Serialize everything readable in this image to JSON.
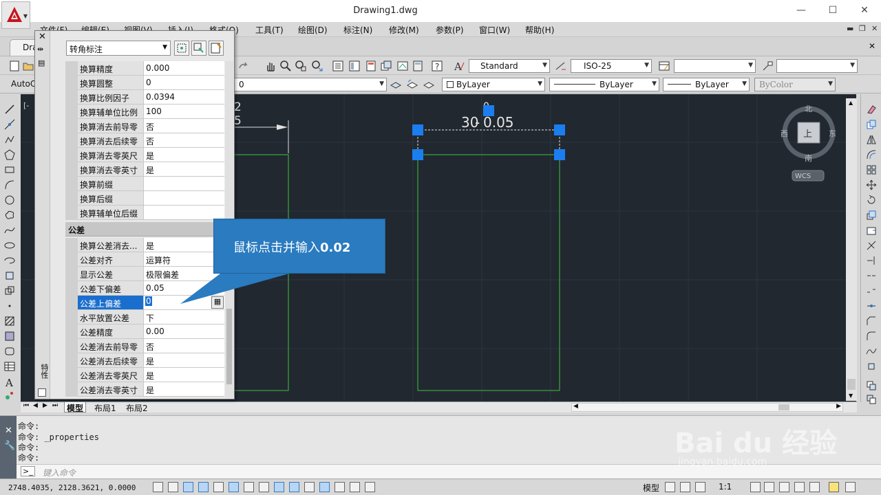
{
  "window": {
    "title": "Drawing1.dwg",
    "minimize": "—",
    "maximize": "☐",
    "close": "✕"
  },
  "menu": [
    "文件(F)",
    "编辑(E)",
    "视图(V)",
    "插入(I)",
    "格式(O)",
    "工具(T)",
    "绘图(D)",
    "标注(N)",
    "修改(M)",
    "参数(P)",
    "窗口(W)",
    "帮助(H)"
  ],
  "doc_tab": "Dra",
  "toolbar1": {
    "text_style": "Standard",
    "dim_style": "ISO-25"
  },
  "toolbar2": {
    "workspace": "AutoC",
    "layer": "0",
    "color": "ByLayer",
    "linetype": "ByLayer",
    "lineweight": "ByLayer",
    "plotstyle": "ByColor"
  },
  "palette": {
    "object_type": "转角标注",
    "side_label": "特性",
    "alt_units_rows": [
      {
        "name": "换算精度",
        "value": "0.000"
      },
      {
        "name": "换算圆整",
        "value": "0"
      },
      {
        "name": "换算比例因子",
        "value": "0.0394"
      },
      {
        "name": "换算辅单位比例",
        "value": "100"
      },
      {
        "name": "换算消去前导零",
        "value": "否"
      },
      {
        "name": "换算消去后续零",
        "value": "否"
      },
      {
        "name": "换算消去零英尺",
        "value": "是"
      },
      {
        "name": "换算消去零英寸",
        "value": "是"
      },
      {
        "name": "换算前缀",
        "value": ""
      },
      {
        "name": "换算后缀",
        "value": ""
      },
      {
        "name": "换算辅单位后缀",
        "value": ""
      }
    ],
    "tolerance_section": "公差",
    "tolerance_rows": [
      {
        "name": "换算公差消去...",
        "value": "是"
      },
      {
        "name": "公差对齐",
        "value": "运算符"
      },
      {
        "name": "显示公差",
        "value": "极限偏差"
      },
      {
        "name": "公差下偏差",
        "value": "0.05"
      },
      {
        "name": "公差上偏差",
        "value": "0"
      },
      {
        "name": "水平放置公差",
        "value": "下"
      },
      {
        "name": "公差精度",
        "value": "0.00"
      },
      {
        "name": "公差消去前导零",
        "value": "否"
      },
      {
        "name": "公差消去后续零",
        "value": "是"
      },
      {
        "name": "公差消去零英尺",
        "value": "是"
      },
      {
        "name": "公差消去零英寸",
        "value": "是"
      }
    ]
  },
  "drawing": {
    "dim_text_left_top": "2",
    "dim_text_left_bottom": "5",
    "dim_text_main": "30",
    "tol_upper": "0",
    "tol_lower": "0.05",
    "viewcube": {
      "north": "北",
      "south": "南",
      "west": "西",
      "east": "东",
      "top": "上",
      "wcs": "WCS"
    },
    "view_label": "[-"
  },
  "callout": {
    "text": "鼠标点击并输入",
    "value": "0.02"
  },
  "layout_tabs": [
    "模型",
    "布局1",
    "布局2"
  ],
  "command_history": [
    "命令:",
    "命令: _properties",
    "命令:",
    "命令:"
  ],
  "command_placeholder": "键入命令",
  "status": {
    "coords": "2748.4035, 2128.3621, 0.0000",
    "model": "模型",
    "scale": "1:1"
  },
  "colors": {
    "canvas": "#212830",
    "grip": "#1a7ef0",
    "green": "#3ec43e",
    "selection": "#1a6fce",
    "callout": "#2a7bc0"
  }
}
